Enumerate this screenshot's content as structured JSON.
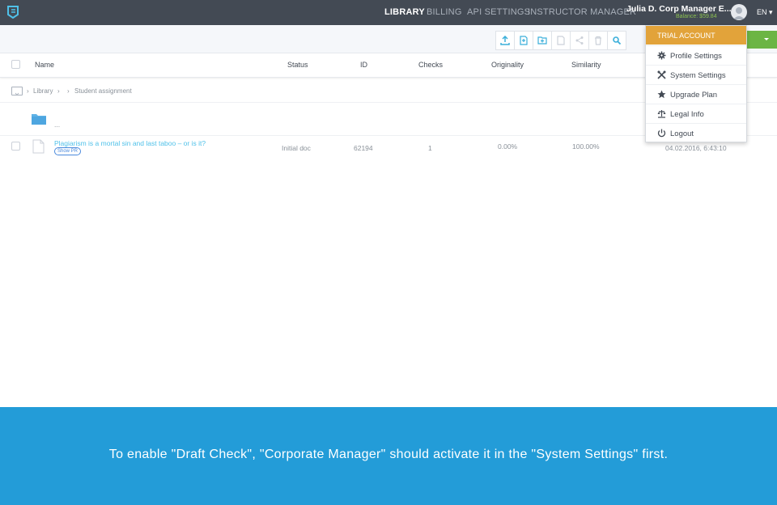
{
  "nav": {
    "items": [
      {
        "label": "LIBRARY",
        "active": true
      },
      {
        "label": "BILLING",
        "active": false
      },
      {
        "label": "API SETTINGS",
        "active": false
      },
      {
        "label": "INSTRUCTOR MANAGER",
        "active": false
      }
    ],
    "user_name": "Julia D. Corp Manager E...",
    "balance": "Balance: $59.84",
    "language": "EN"
  },
  "toolbar": {
    "icons": [
      "upload-icon",
      "new-document-icon",
      "new-folder-icon",
      "document-icon",
      "share-icon",
      "trash-icon",
      "search-icon"
    ]
  },
  "table": {
    "columns": [
      "Name",
      "Status",
      "ID",
      "Checks",
      "Originality",
      "Similarity"
    ],
    "breadcrumb": [
      "Library",
      "Student assignment"
    ],
    "folder_row": {
      "name": "..."
    },
    "rows": [
      {
        "name": "Plagiarism is a mortal sin and last taboo – or is it?",
        "badge": "Show PR",
        "status": "Initial doc",
        "id": "62194",
        "checks": "1",
        "originality": "0.00%",
        "similarity": "100.00%",
        "date": "04.02.2016, 6:43:10"
      }
    ]
  },
  "user_menu": {
    "header": "TRIAL ACCOUNT",
    "items": [
      {
        "label": "Profile Settings",
        "icon": "gear-icon"
      },
      {
        "label": "System Settings",
        "icon": "tools-icon"
      },
      {
        "label": "Upgrade Plan",
        "icon": "star-icon"
      },
      {
        "label": "Legal Info",
        "icon": "scales-icon"
      },
      {
        "label": "Logout",
        "icon": "power-icon"
      }
    ]
  },
  "banner": {
    "text": "To enable \"Draft Check\", \"Corporate Manager\" should activate it in the \"System Settings\" first."
  },
  "colors": {
    "topbar": "#434a54",
    "menu_header": "#e2a33a",
    "banner": "#239cd8",
    "link": "#4fc1e9",
    "green": "#6cb544"
  }
}
